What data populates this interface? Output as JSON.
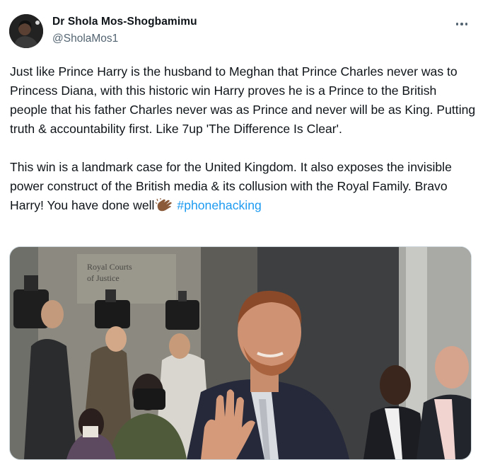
{
  "author": {
    "display_name": "Dr Shola Mos-Shogbamimu",
    "handle": "@SholaMos1"
  },
  "tweet": {
    "paragraph_1": "Just like Prince Harry is the husband to Meghan that Prince Charles never was to Princess Diana, with this historic win Harry proves he is a Prince to the British people that his father Charles never was as Prince and never will be as King. Putting truth & accountability first. Like 7up 'The Difference Is Clear'.",
    "paragraph_2": "This win is a landmark case for the United Kingdom. It also exposes the invisible power construct of the British media & its collusion with the Royal Family. Bravo Harry! You have done well",
    "emoji": "clapping-hands",
    "hashtag": "#phonehacking"
  },
  "photo": {
    "sign_line_1": "Royal Courts",
    "sign_line_2": "of Justice"
  },
  "colors": {
    "text": "#0f1419",
    "secondary": "#536471",
    "link": "#1d9bf0",
    "border": "#cfd9de"
  }
}
